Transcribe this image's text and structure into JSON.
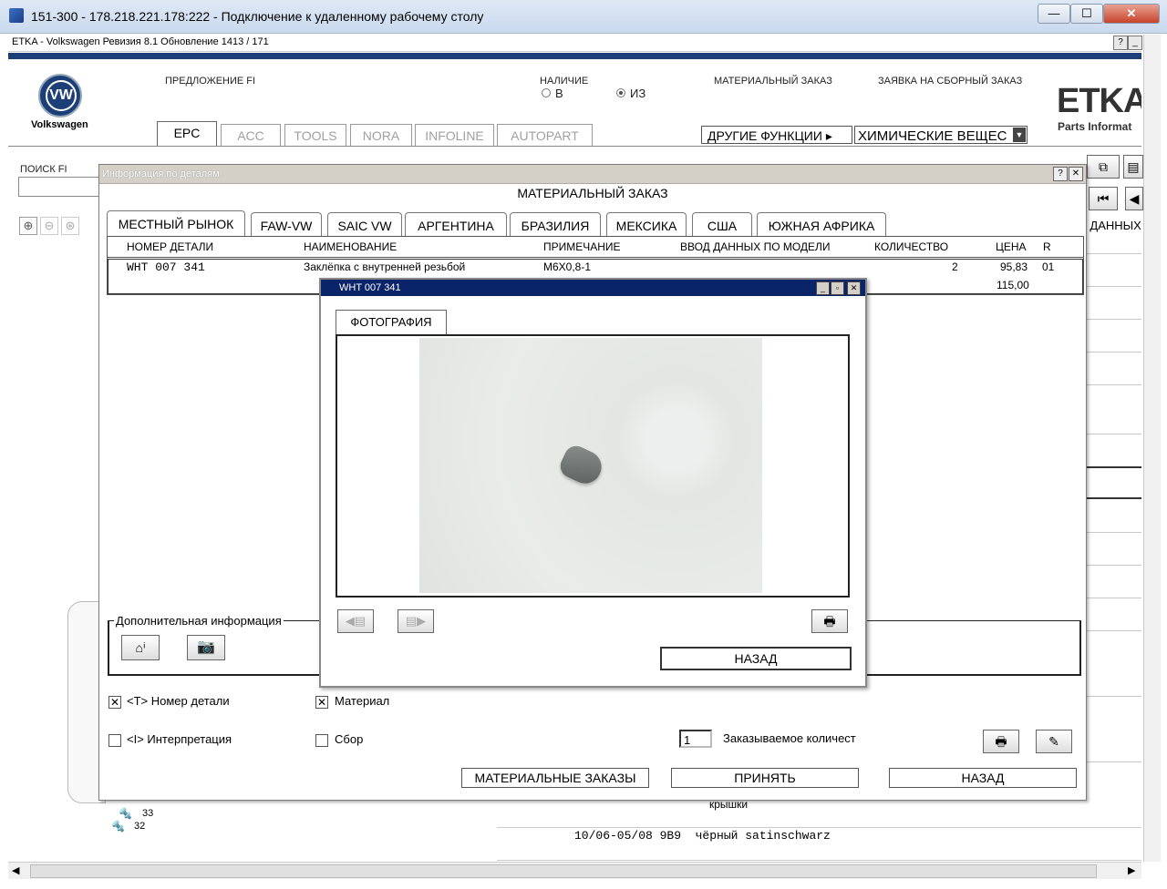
{
  "rdp": {
    "title": "151-300 - 178.218.221.178:222 - Подключение к удаленному рабочему столу",
    "min": "—",
    "max": "☐",
    "close": "✕"
  },
  "etka": {
    "title": "ETKA - Volkswagen Ревизия 8.1 Обновление 1413 / 171",
    "help": "?",
    "min": "_"
  },
  "header": {
    "brand": "Volkswagen",
    "offer": "ПРЕДЛОЖЕНИЕ FI",
    "availability": "НАЛИЧИЕ",
    "radio_v": "В",
    "radio_iz": "ИЗ",
    "material_order": "МАТЕРИАЛЬНЫЙ ЗАКАЗ",
    "assembly_order": "ЗАЯВКА НА СБОРНЫЙ ЗАКАЗ",
    "logo_main": "ETKA",
    "logo_sub": "Parts Informat",
    "tabs": [
      "EPC",
      "ACC",
      "TOOLS",
      "NORA",
      "INFOLINE",
      "AUTOPART"
    ],
    "other_functions": "ДРУГИЕ ФУНКЦИИ ▸",
    "chemicals": "ХИМИЧЕСКИЕ ВЕЩЕС",
    "search_label": "ПОИСК FI",
    "right_col_partial": "Д ДАННЫХ"
  },
  "dialog": {
    "title": "Информация по деталям",
    "heading": "МАТЕРИАЛЬНЫЙ ЗАКАЗ",
    "markets": [
      "МЕСТНЫЙ РЫНОК",
      "FAW-VW",
      "SAIC VW",
      "АРГЕНТИНА",
      "БРАЗИЛИЯ",
      "МЕКСИКА",
      "США",
      "ЮЖНАЯ АФРИКА"
    ],
    "columns": [
      "НОМЕР ДЕТАЛИ",
      "НАИМЕНОВАНИЕ",
      "ПРИМЕЧАНИЕ",
      "ВВОД ДАННЫХ ПО МОДЕЛИ",
      "КОЛИЧЕСТВО",
      "ЦЕНА",
      "R"
    ],
    "row": {
      "part": "WHT 007 341",
      "name": "Заклёпка с внутренней резьбой",
      "note": "M6X0,8-1",
      "qty": "2",
      "price": "95,83",
      "r": "01",
      "total": "115,00"
    },
    "extra_info": "Дополнительная информация",
    "opt_part_number": "<T> Номер детали",
    "opt_material": "Материал",
    "opt_interpretation": "<I> Интерпретация",
    "opt_assembly": "Сбор",
    "order_qty_value": "1",
    "order_qty_label": "Заказываемое количест",
    "btn_material_orders": "МАТЕРИАЛЬНЫЕ ЗАКАЗЫ",
    "btn_accept": "ПРИНЯТЬ",
    "btn_back": "НАЗАД",
    "checked": "✕"
  },
  "photo": {
    "title": "WHT 007 341",
    "tab": "ФОТОГРАФИЯ",
    "btn_back": "НАЗАД"
  },
  "background": {
    "callout_33": "33",
    "callout_32": "32",
    "cover_text": "крышки",
    "row_text": "10/06-05/08 9B9  чёрный satinschwarz"
  }
}
